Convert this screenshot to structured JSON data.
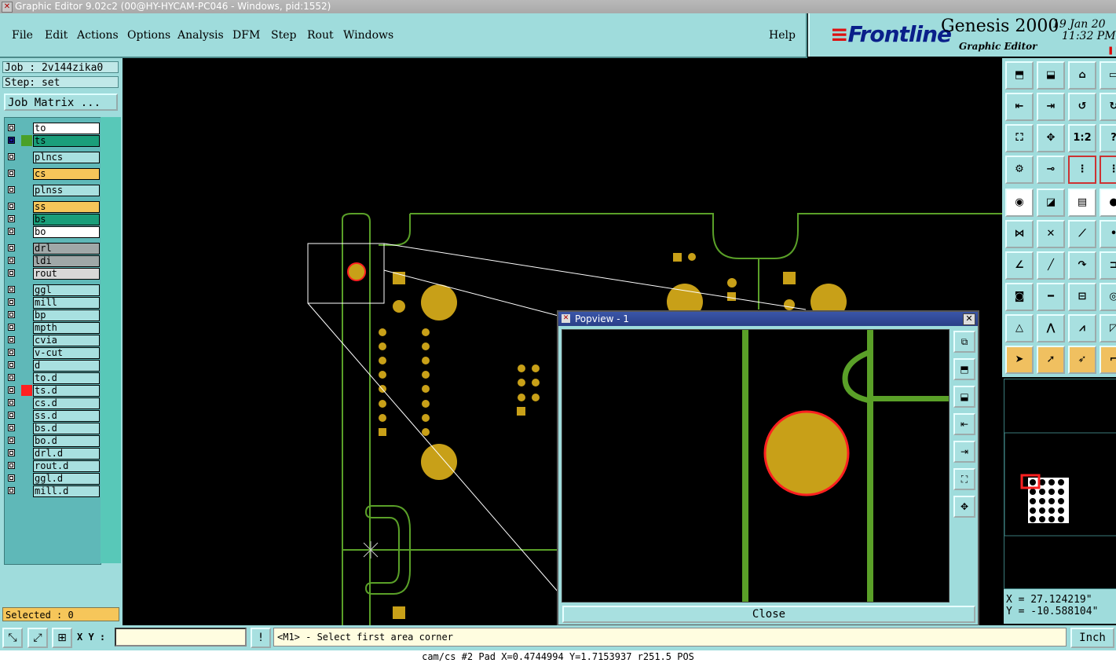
{
  "window": {
    "title": "Graphic Editor 9.02c2 (00@HY-HYCAM-PC046 - Windows, pid:1552)"
  },
  "menu": {
    "file": "File",
    "edit": "Edit",
    "actions": "Actions",
    "options": "Options",
    "analysis": "Analysis",
    "dfm": "DFM",
    "step": "Step",
    "rout": "Rout",
    "windows": "Windows",
    "help": "Help"
  },
  "brand": {
    "logo": "Frontline",
    "product": "Genesis 2000",
    "module": "Graphic Editor",
    "date": "19 Jan 20",
    "time": "11:32 PM"
  },
  "job": {
    "job_label": "Job : 2v144zika0",
    "step_label": "Step: set",
    "matrix_button": "Job Matrix ..."
  },
  "layers": [
    {
      "name": "to",
      "color": "#ffffff"
    },
    {
      "name": "ts",
      "color": "#1a9e7a",
      "active": true
    },
    {
      "name": "plncs",
      "color": "#a8e0e0"
    },
    {
      "name": "cs",
      "color": "#f6c65a"
    },
    {
      "name": "plnss",
      "color": "#a8e0e0"
    },
    {
      "name": "ss",
      "color": "#f6c65a"
    },
    {
      "name": "bs",
      "color": "#1a9e7a"
    },
    {
      "name": "bo",
      "color": "#ffffff"
    },
    {
      "name": "drl",
      "color": "#a0a8a8"
    },
    {
      "name": "ldi",
      "color": "#a0a8a8"
    },
    {
      "name": "rout",
      "color": "#d8d8d8"
    },
    {
      "name": "ggl",
      "color": "#a8e0e0"
    },
    {
      "name": "mill",
      "color": "#a8e0e0"
    },
    {
      "name": "bp",
      "color": "#a8e0e0"
    },
    {
      "name": "mpth",
      "color": "#a8e0e0"
    },
    {
      "name": "cvia",
      "color": "#a8e0e0"
    },
    {
      "name": "v-cut",
      "color": "#a8e0e0"
    },
    {
      "name": "d",
      "color": "#a8e0e0"
    },
    {
      "name": "to.d",
      "color": "#a8e0e0"
    },
    {
      "name": "ts.d",
      "color": "#a8e0e0",
      "swatch": "#ff2020"
    },
    {
      "name": "cs.d",
      "color": "#a8e0e0"
    },
    {
      "name": "ss.d",
      "color": "#a8e0e0"
    },
    {
      "name": "bs.d",
      "color": "#a8e0e0"
    },
    {
      "name": "bo.d",
      "color": "#a8e0e0"
    },
    {
      "name": "drl.d",
      "color": "#a8e0e0"
    },
    {
      "name": "rout.d",
      "color": "#a8e0e0"
    },
    {
      "name": "ggl.d",
      "color": "#a8e0e0"
    },
    {
      "name": "mill.d",
      "color": "#a8e0e0"
    }
  ],
  "selected": "Selected : 0",
  "coords": {
    "x": "X = 27.124219\"",
    "y": "Y = -10.588104\""
  },
  "bottom": {
    "xy_label": "X Y :",
    "xy_value": "",
    "message": "<M1> - Select first area corner",
    "unit": "Inch",
    "status": "cam/cs #2 Pad X=0.4744994 Y=1.7153937 r251.5 POS"
  },
  "popview": {
    "title": "Popview - 1",
    "close_label": "Close"
  },
  "colors": {
    "trace_green": "#5aa028",
    "pad_gold": "#c8a018",
    "highlight_red": "#ff2020",
    "panel_cyan": "#9fdcdc"
  }
}
